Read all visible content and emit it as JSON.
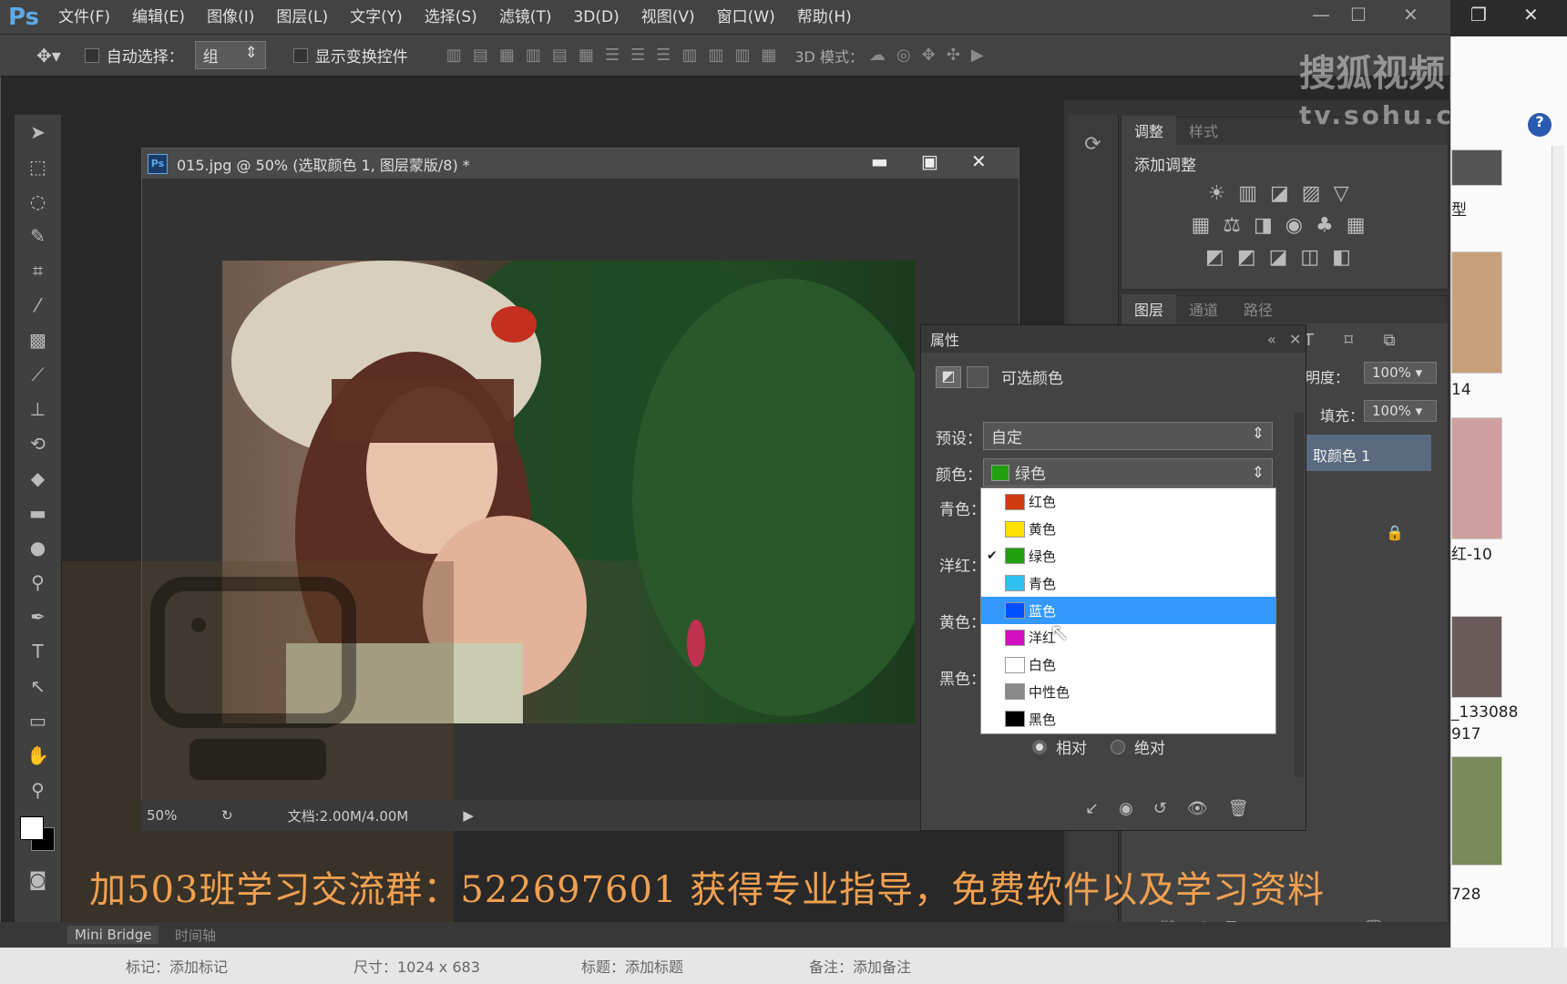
{
  "app": {
    "logo": "Ps",
    "menu": [
      "文件(F)",
      "编辑(E)",
      "图像(I)",
      "图层(L)",
      "文字(Y)",
      "选择(S)",
      "滤镜(T)",
      "3D(D)",
      "视图(V)",
      "窗口(W)",
      "帮助(H)"
    ]
  },
  "options": {
    "auto_select_label": "自动选择：",
    "auto_select_value": "组",
    "show_transform_label": "显示变换控件",
    "mode_3d_label": "3D 模式："
  },
  "document": {
    "title": "015.jpg @ 50% (选取颜色 1, 图层蒙版/8) *",
    "badge": "Ps",
    "zoom": "50%",
    "doc_info": "文档:2.00M/4.00M"
  },
  "adjust_panel": {
    "tabs": [
      "调整",
      "样式"
    ],
    "heading": "添加调整"
  },
  "layers_panel": {
    "tabs": [
      "图层",
      "通道",
      "路径"
    ],
    "opacity_label": "不透明度：",
    "opacity_value": "100%",
    "fill_label": "填充：",
    "fill_value": "100%",
    "layer_name": "取颜色 1"
  },
  "properties": {
    "tab": "属性",
    "title": "可选颜色",
    "preset_label": "预设：",
    "preset_value": "自定",
    "color_label": "颜色：",
    "color_value": "绿色",
    "slider_labels": [
      "青色：",
      "洋红：",
      "黄色：",
      "黑色："
    ],
    "radio_relative": "相对",
    "radio_absolute": "绝对"
  },
  "color_dropdown": {
    "items": [
      {
        "label": "红色",
        "color": "#d23a10"
      },
      {
        "label": "黄色",
        "color": "#ffe000"
      },
      {
        "label": "绿色",
        "color": "#22a010"
      },
      {
        "label": "青色",
        "color": "#30c0f0"
      },
      {
        "label": "蓝色",
        "color": "#0050ff"
      },
      {
        "label": "洋红",
        "color": "#d010c0"
      },
      {
        "label": "白色",
        "color": "#ffffff"
      },
      {
        "label": "中性色",
        "color": "#888888"
      },
      {
        "label": "黑色",
        "color": "#000000"
      }
    ],
    "checked_index": 2,
    "highlight_index": 4
  },
  "bottom": {
    "mini_bridge": "Mini Bridge",
    "timeline": "时间轴",
    "caption": "加503班学习交流群：522697601 获得专业指导，免费软件以及学习资料"
  },
  "bridge_bar": {
    "tag": "标记：添加标记",
    "size": "尺寸：1024 x 683",
    "title": "标题：添加标题",
    "note": "备注：添加备注"
  },
  "watermark": {
    "sohu": "搜狐视频",
    "sohu_url": "tv.sohu.com"
  },
  "explorer": {
    "labels": [
      "型",
      "14",
      "红-10",
      "_133088",
      "917",
      "728"
    ]
  }
}
